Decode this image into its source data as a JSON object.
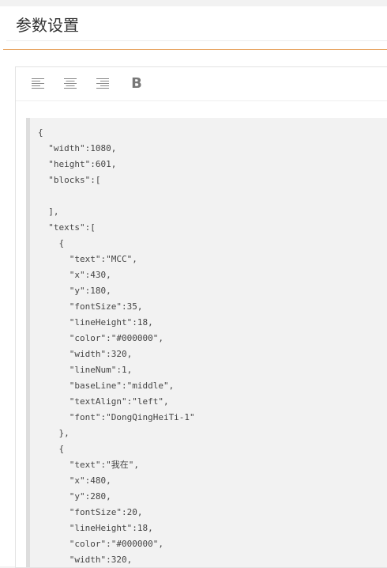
{
  "header": {
    "title": "参数设置"
  },
  "toolbar": {
    "align_left_icon": "align-left-icon",
    "align_center_icon": "align-center-icon",
    "align_right_icon": "align-right-icon",
    "bold_label": "B"
  },
  "code": {
    "lines": [
      "{",
      "  \"width\":1080,",
      "  \"height\":601,",
      "  \"blocks\":[",
      "",
      "  ],",
      "  \"texts\":[",
      "    {",
      "      \"text\":\"MCC\",",
      "      \"x\":430,",
      "      \"y\":180,",
      "      \"fontSize\":35,",
      "      \"lineHeight\":18,",
      "      \"color\":\"#000000\",",
      "      \"width\":320,",
      "      \"lineNum\":1,",
      "      \"baseLine\":\"middle\",",
      "      \"textAlign\":\"left\",",
      "      \"font\":\"DongQingHeiTi-1\"",
      "    },",
      "    {",
      "      \"text\":\"我在\",",
      "      \"x\":480,",
      "      \"y\":280,",
      "      \"fontSize\":20,",
      "      \"lineHeight\":18,",
      "      \"color\":\"#000000\",",
      "      \"width\":320,"
    ]
  }
}
